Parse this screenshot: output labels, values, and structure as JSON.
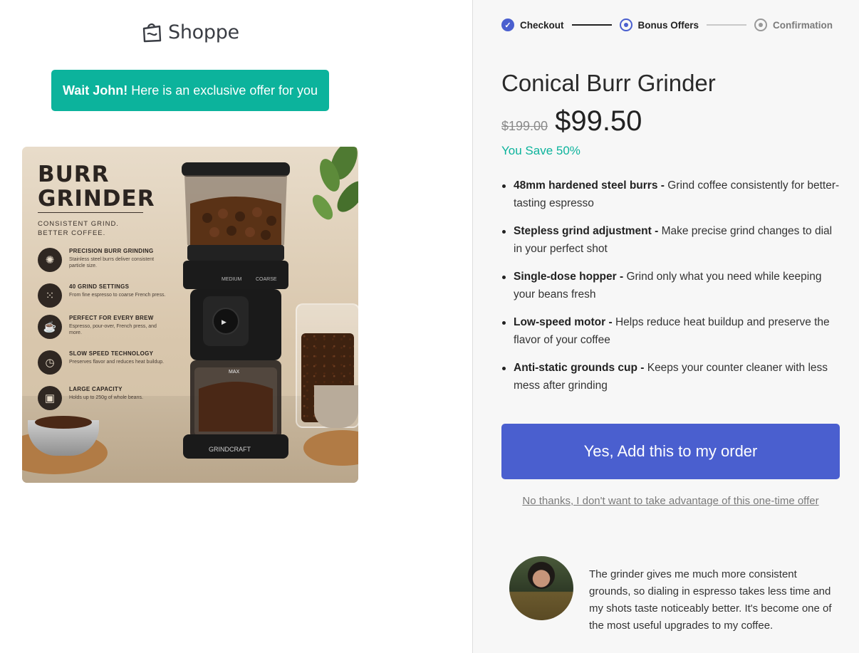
{
  "brand": {
    "name": "Shoppe",
    "logo_icon": "shopping-bag-icon"
  },
  "banner": {
    "name": "Wait John!",
    "message": "Here is an exclusive offer for you"
  },
  "product_image": {
    "title_line1": "BURR",
    "title_line2": "GRINDER",
    "tagline_line1": "CONSISTENT GRIND.",
    "tagline_line2": "BETTER COFFEE.",
    "features": [
      {
        "title": "PRECISION BURR GRINDING",
        "desc": "Stainless steel burrs deliver consistent particle size.",
        "icon": "burr-icon"
      },
      {
        "title": "40 GRIND SETTINGS",
        "desc": "From fine espresso to coarse French press.",
        "icon": "grind-dots-icon"
      },
      {
        "title": "PERFECT FOR EVERY BREW",
        "desc": "Espresso, pour-over, French press, and more.",
        "icon": "cup-icon"
      },
      {
        "title": "SLOW SPEED TECHNOLOGY",
        "desc": "Preserves flavor and reduces heat buildup.",
        "icon": "timer-icon"
      },
      {
        "title": "LARGE CAPACITY",
        "desc": "Holds up to 250g of whole beans.",
        "icon": "jar-icon"
      }
    ],
    "brand_mark": "GRINDCRAFT",
    "dial_labels": [
      "MEDIUM",
      "COARSE"
    ],
    "max_label": "MAX"
  },
  "steps": [
    {
      "label": "Checkout",
      "state": "done"
    },
    {
      "label": "Bonus Offers",
      "state": "current"
    },
    {
      "label": "Confirmation",
      "state": "upcoming"
    }
  ],
  "product": {
    "title": "Conical Burr Grinder",
    "old_price": "$199.00",
    "new_price": "$99.50",
    "savings": "You Save 50%",
    "features": [
      {
        "bold": "48mm hardened steel burrs -",
        "text": " Grind coffee consistently for better-tasting espresso"
      },
      {
        "bold": "Stepless grind adjustment -",
        "text": " Make precise grind changes to dial in your perfect shot"
      },
      {
        "bold": "Single-dose hopper -",
        "text": " Grind only what you need while keeping your beans fresh"
      },
      {
        "bold": "Low-speed motor -",
        "text": " Helps reduce heat buildup and preserve the flavor of your coffee"
      },
      {
        "bold": "Anti-static grounds cup -",
        "text": " Keeps your counter cleaner with less mess after grinding"
      }
    ]
  },
  "actions": {
    "accept_label": "Yes, Add this to my order",
    "decline_label": "No thanks, I don't want to take advantage of this one-time offer"
  },
  "testimonial": {
    "quote": "The grinder gives me much more consistent grounds, so dialing in espresso takes less time and my shots taste noticeably better. It's become one of the most useful upgrades to my coffee."
  },
  "colors": {
    "teal": "#0cb39c",
    "accent": "#4a5fcf",
    "panel": "#f7f7f7"
  }
}
